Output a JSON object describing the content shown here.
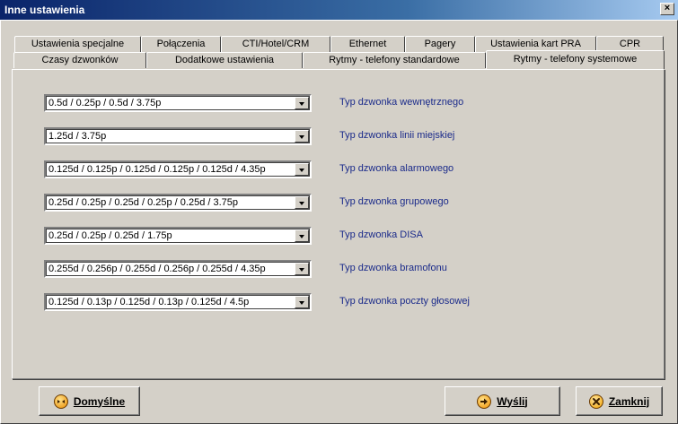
{
  "window": {
    "title": "Inne ustawienia",
    "close_glyph": "×"
  },
  "tabs_back": [
    "Ustawienia specjalne",
    "Połączenia",
    "CTI/Hotel/CRM",
    "Ethernet",
    "Pagery",
    "Ustawienia kart PRA",
    "CPR"
  ],
  "tabs_front": [
    "Czasy dzwonków",
    "Dodatkowe ustawienia",
    "Rytmy - telefony standardowe",
    "Rytmy - telefony systemowe"
  ],
  "active_tab": "Rytmy - telefony systemowe",
  "rows": [
    {
      "value": "0.5d / 0.25p / 0.5d / 3.75p",
      "label": "Typ dzwonka wewnętrznego"
    },
    {
      "value": "1.25d / 3.75p",
      "label": "Typ dzwonka linii miejskiej"
    },
    {
      "value": "0.125d / 0.125p / 0.125d / 0.125p / 0.125d / 4.35p",
      "label": "Typ dzwonka alarmowego"
    },
    {
      "value": "0.25d / 0.25p / 0.25d / 0.25p / 0.25d / 3.75p",
      "label": "Typ dzwonka grupowego"
    },
    {
      "value": "0.25d / 0.25p / 0.25d / 1.75p",
      "label": "Typ dzwonka DISA"
    },
    {
      "value": "0.255d / 0.256p / 0.255d / 0.256p / 0.255d / 4.35p",
      "label": "Typ dzwonka bramofonu"
    },
    {
      "value": "0.125d / 0.13p / 0.125d / 0.13p / 0.125d / 4.5p",
      "label": "Typ dzwonka poczty głosowej"
    }
  ],
  "buttons": {
    "default": {
      "label": "Domyślne",
      "icon": "default-icon"
    },
    "send": {
      "label": "Wyślij",
      "icon": "arrow-right-icon"
    },
    "close": {
      "label": "Zamknij",
      "icon": "x-icon"
    }
  },
  "colors": {
    "title_bar": "#0a246a",
    "label_text": "#1a2a8a",
    "face": "#d4d0c8"
  }
}
